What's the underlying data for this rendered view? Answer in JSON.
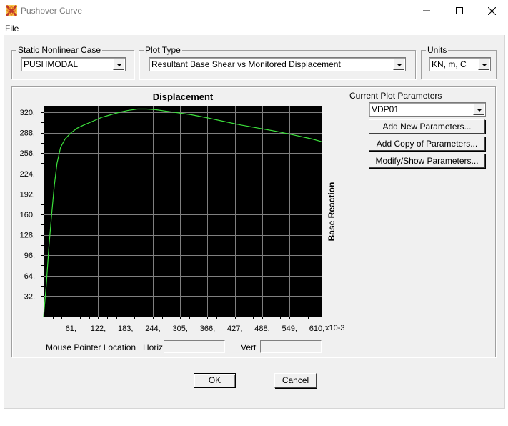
{
  "window": {
    "title": "Pushover Curve",
    "icon": "app-icon",
    "minimize_icon": "minimize-icon",
    "maximize_icon": "maximize-icon",
    "close_icon": "close-icon"
  },
  "menu": {
    "file_label": "File"
  },
  "static_case": {
    "label": "Static Nonlinear Case",
    "value": "PUSHMODAL"
  },
  "plot_type": {
    "label": "Plot Type",
    "value": "Resultant Base Shear vs Monitored Displacement"
  },
  "units": {
    "label": "Units",
    "value": "KN, m, C"
  },
  "plot_params": {
    "label": "Current Plot Parameters",
    "value": "VDP01",
    "add_new_label": "Add New Parameters...",
    "add_copy_label": "Add Copy of Parameters...",
    "modify_show_label": "Modify/Show Parameters..."
  },
  "mouse": {
    "location_label": "Mouse Pointer Location",
    "horiz_label": "Horiz",
    "vert_label": "Vert",
    "horiz_value": "",
    "vert_value": ""
  },
  "buttons": {
    "ok_label": "OK",
    "cancel_label": "Cancel"
  },
  "colors": {
    "plot_bg": "#000000",
    "grid": "#7f7f7f",
    "curve": "#3ce03c",
    "dialog_bg": "#f0f0f0"
  },
  "chart_data": {
    "type": "line",
    "title": "Displacement",
    "xlabel": "",
    "ylabel": "Base Reaction",
    "x_multiplier_label": "x10-3",
    "xlim": [
      0,
      622
    ],
    "ylim": [
      0,
      330
    ],
    "x_ticks": [
      61,
      122,
      183,
      244,
      305,
      366,
      427,
      488,
      549,
      610
    ],
    "x_tick_labels": [
      "61,",
      "122,",
      "183,",
      "244,",
      "305,",
      "366,",
      "427,",
      "488,",
      "549,",
      "610,"
    ],
    "y_ticks": [
      32,
      64,
      96,
      128,
      160,
      192,
      224,
      256,
      288,
      320
    ],
    "y_tick_labels": [
      "32,",
      "64,",
      "96,",
      "128,",
      "160,",
      "192,",
      "224,",
      "256,",
      "288,",
      "320,"
    ],
    "grid": true,
    "series": [
      {
        "points": [
          [
            0,
            0
          ],
          [
            6,
            50
          ],
          [
            12,
            110
          ],
          [
            18,
            160
          ],
          [
            24,
            205
          ],
          [
            30,
            240
          ],
          [
            38,
            265
          ],
          [
            48,
            278
          ],
          [
            60,
            287
          ],
          [
            75,
            295
          ],
          [
            90,
            300
          ],
          [
            110,
            306
          ],
          [
            130,
            312
          ],
          [
            150,
            316
          ],
          [
            170,
            320
          ],
          [
            190,
            323
          ],
          [
            210,
            325
          ],
          [
            230,
            325
          ],
          [
            250,
            324
          ],
          [
            270,
            322
          ],
          [
            300,
            319
          ],
          [
            330,
            316
          ],
          [
            360,
            312
          ],
          [
            400,
            306
          ],
          [
            440,
            300
          ],
          [
            480,
            295
          ],
          [
            520,
            290
          ],
          [
            560,
            284
          ],
          [
            600,
            278
          ],
          [
            620,
            274
          ]
        ]
      }
    ]
  }
}
